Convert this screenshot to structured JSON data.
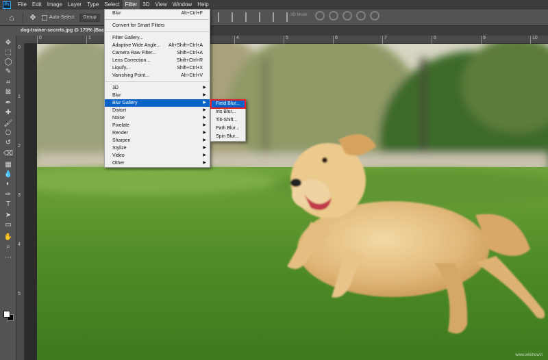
{
  "app": {
    "logo": "Ps"
  },
  "menubar": {
    "items": [
      "File",
      "Edit",
      "Image",
      "Layer",
      "Type",
      "Select",
      "Filter",
      "3D",
      "View",
      "Window",
      "Help"
    ],
    "active": "Filter"
  },
  "options": {
    "auto_select_label": "Auto-Select",
    "group_select": "Group",
    "threed_mode_label": "3D Mode:"
  },
  "document": {
    "tab_title": "dog-trainer-secrets.jpg @ 170% (Backgr..."
  },
  "ruler": {
    "top_ticks": [
      "0",
      "1",
      "2",
      "3",
      "4",
      "5",
      "6",
      "7",
      "8",
      "9",
      "10"
    ],
    "left_ticks": [
      "0",
      "1",
      "2",
      "3",
      "4",
      "5"
    ]
  },
  "filter_menu": {
    "items": [
      {
        "label": "Blur",
        "shortcut": "Alt+Ctrl+F"
      },
      {
        "sep": true
      },
      {
        "label": "Convert for Smart Filters"
      },
      {
        "sep": true
      },
      {
        "label": "Filter Gallery..."
      },
      {
        "label": "Adaptive Wide Angle...",
        "shortcut": "Alt+Shift+Ctrl+A"
      },
      {
        "label": "Camera Raw Filter...",
        "shortcut": "Shift+Ctrl+A"
      },
      {
        "label": "Lens Correction...",
        "shortcut": "Shift+Ctrl+R"
      },
      {
        "label": "Liquify...",
        "shortcut": "Shift+Ctrl+X"
      },
      {
        "label": "Vanishing Point...",
        "shortcut": "Alt+Ctrl+V"
      },
      {
        "sep": true
      },
      {
        "label": "3D",
        "submenu": true
      },
      {
        "label": "Blur",
        "submenu": true
      },
      {
        "label": "Blur Gallery",
        "submenu": true,
        "highlight": true
      },
      {
        "label": "Distort",
        "submenu": true
      },
      {
        "label": "Noise",
        "submenu": true
      },
      {
        "label": "Pixelate",
        "submenu": true
      },
      {
        "label": "Render",
        "submenu": true
      },
      {
        "label": "Sharpen",
        "submenu": true
      },
      {
        "label": "Stylize",
        "submenu": true
      },
      {
        "label": "Video",
        "submenu": true
      },
      {
        "label": "Other",
        "submenu": true
      }
    ]
  },
  "blur_gallery_submenu": {
    "items": [
      "Field Blur...",
      "Iris Blur...",
      "Tilt-Shift...",
      "Path Blur...",
      "Spin Blur..."
    ],
    "selected": "Field Blur..."
  },
  "watermark": "www.wikihow.it",
  "colors": {
    "menubar_bg": "#3c3c3c",
    "panel_bg": "#535353",
    "menu_bg": "#f0f0f0",
    "highlight": "#0a64c8",
    "selection_outline": "#e0202a"
  },
  "icons": {
    "toolbox": [
      "move-icon",
      "marquee-icon",
      "lasso-icon",
      "quick-select-icon",
      "crop-icon",
      "frame-icon",
      "eyedropper-icon",
      "healing-brush-icon",
      "brush-icon",
      "clone-stamp-icon",
      "history-brush-icon",
      "eraser-icon",
      "gradient-icon",
      "blur-tool-icon",
      "dodge-icon",
      "pen-icon",
      "type-icon",
      "path-select-icon",
      "rectangle-icon",
      "hand-icon",
      "zoom-icon",
      "more-tools-icon"
    ]
  }
}
